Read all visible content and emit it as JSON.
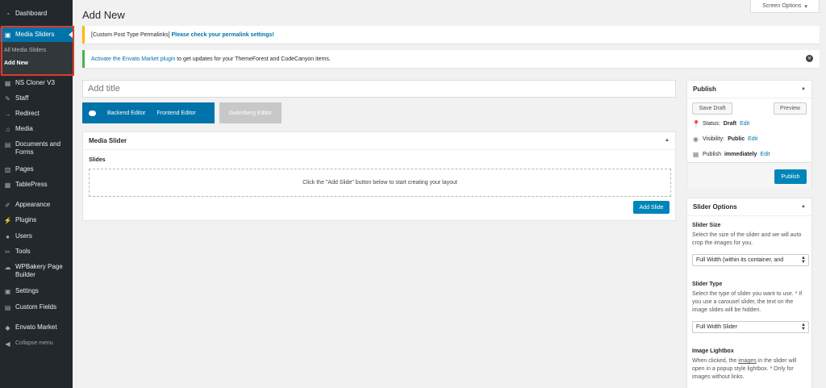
{
  "sidebar": {
    "items": [
      {
        "label": "Dashboard",
        "icon": "dashboard-icon"
      },
      {
        "label": "Media Sliders",
        "icon": "media-sliders-icon"
      },
      {
        "label": "NS Cloner V3",
        "icon": "cloner-icon"
      },
      {
        "label": "Staff",
        "icon": "staff-icon"
      },
      {
        "label": "Redirect",
        "icon": "redirect-arrow-icon"
      },
      {
        "label": "Media",
        "icon": "media-icon"
      },
      {
        "label": "Documents and",
        "label2": "Forms",
        "icon": "documents-icon"
      },
      {
        "label": "Pages",
        "icon": "pages-icon"
      },
      {
        "label": "TablePress",
        "icon": "tablepress-icon"
      },
      {
        "label": "Appearance",
        "icon": "appearance-brush-icon"
      },
      {
        "label": "Plugins",
        "icon": "plugins-icon"
      },
      {
        "label": "Users",
        "icon": "users-icon"
      },
      {
        "label": "Tools",
        "icon": "tools-wrench-icon"
      },
      {
        "label": "WPBakery Page",
        "label2": "Builder",
        "icon": "wpbakery-icon"
      },
      {
        "label": "Settings",
        "icon": "settings-icon"
      },
      {
        "label": "Custom Fields",
        "icon": "custom-fields-icon"
      },
      {
        "label": "Envato Market",
        "icon": "envato-icon"
      },
      {
        "label": "Collapse menu",
        "icon": "collapse-icon"
      }
    ],
    "submenu": [
      "All Media Sliders",
      "Add New"
    ]
  },
  "header": {
    "title": "Add New",
    "screen_options": "Screen Options"
  },
  "notices": {
    "permalink_text": "[Custom Post Type Permalinks]",
    "permalink_link": "Please check your permalink settings!",
    "envato_link": "Activate the Envato Market plugin",
    "envato_text": "to get updates for your ThemeForest and CodeCanyon items."
  },
  "editor": {
    "title_placeholder": "Add title",
    "backend": "Backend Editor",
    "frontend": "Frontend Editor",
    "gutenberg": "Gutenberg Editor"
  },
  "media_slider": {
    "heading": "Media Slider",
    "slides_label": "Slides",
    "empty_text": "Click the \"Add Slide\" button below to start creating your layout",
    "add_slide": "Add Slide"
  },
  "publish": {
    "heading": "Publish",
    "save_draft": "Save Draft",
    "preview": "Preview",
    "status_label": "Status:",
    "status_value": "Draft",
    "visibility_label": "Visibility:",
    "visibility_value": "Public",
    "publish_label": "Publish",
    "publish_value": "immediately",
    "edit": "Edit",
    "publish_button": "Publish"
  },
  "slider_options": {
    "heading": "Slider Options",
    "size_title": "Slider Size",
    "size_desc": "Select the size of the slider and we will auto crop the images for you.",
    "size_value": "Full Width (within its container, and",
    "type_title": "Slider Type",
    "type_desc": "Select the type of slider you want to use. * If you use a carousel slider, the text on the image slides will be hidden.",
    "type_value": "Full Width Slider",
    "lightbox_title": "Image Lightbox",
    "lightbox_desc_pre": "When clicked, the ",
    "lightbox_desc_images": "images",
    "lightbox_desc_post": " in the slider will open in a popup style lightbox. * Only for images without links."
  },
  "colors": {
    "sidebar_bg": "#23282d",
    "accent": "#0073aa",
    "highlight_border": "#dd3b2c"
  }
}
